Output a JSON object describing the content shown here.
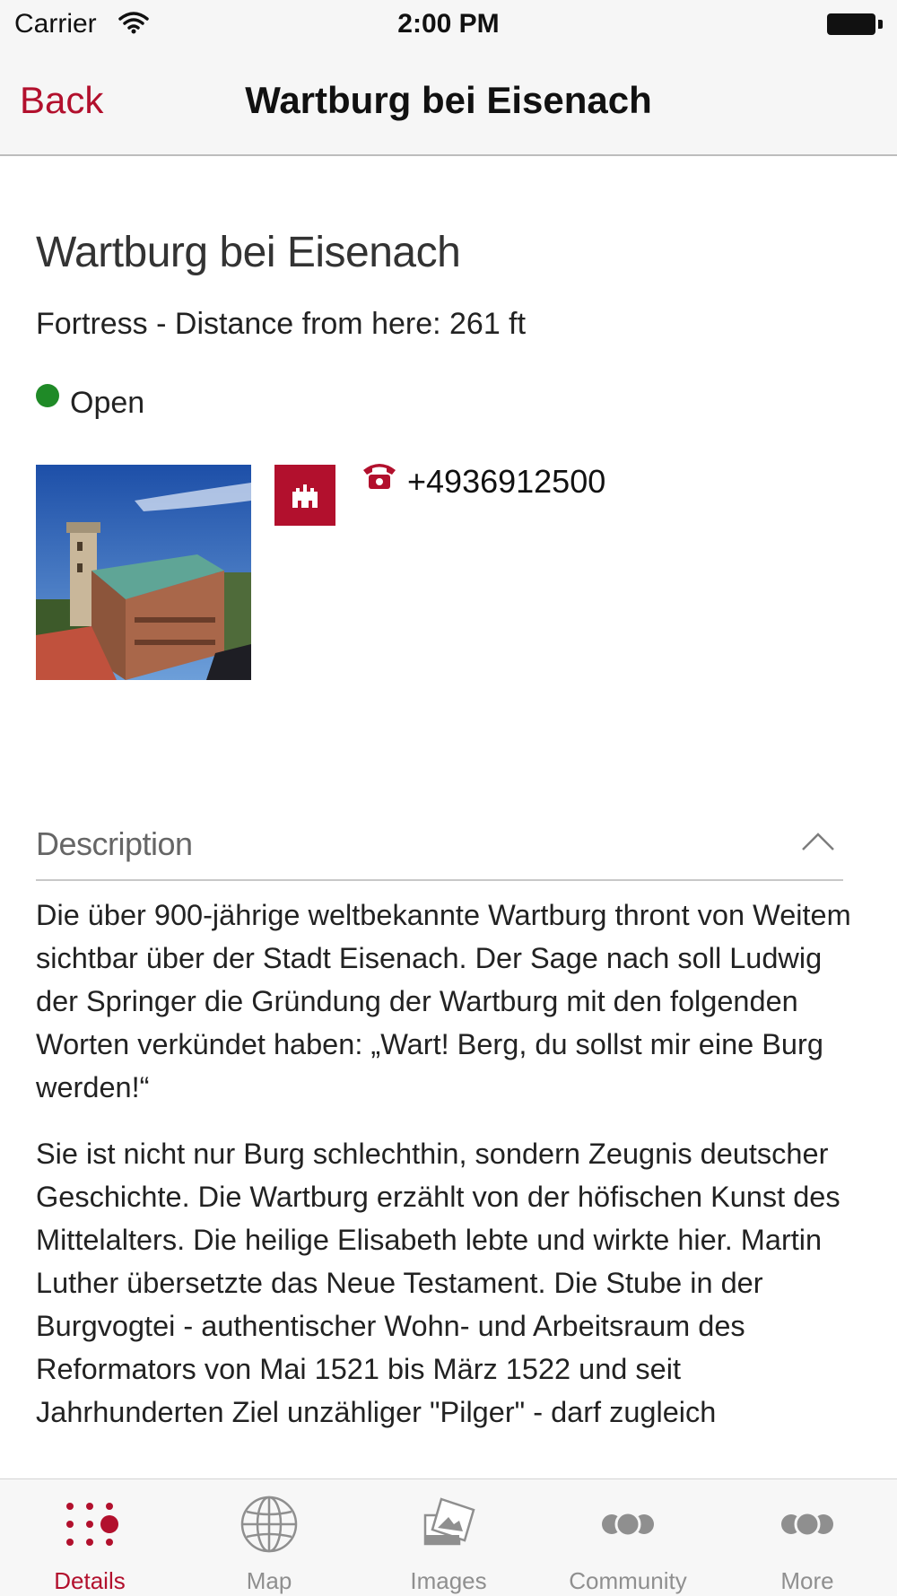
{
  "status_bar": {
    "carrier": "Carrier",
    "time": "2:00 PM"
  },
  "nav": {
    "back_label": "Back",
    "title": "Wartburg bei Eisenach"
  },
  "place": {
    "title": "Wartburg bei Eisenach",
    "subtitle": "Fortress - Distance from here: 261 ft",
    "status": "Open",
    "status_color": "#1f8a27",
    "phone": "+4936912500"
  },
  "description": {
    "label": "Description",
    "paragraphs": [
      "Die über 900-jährige weltbekannte Wartburg thront von Weitem sichtbar über der Stadt Eisenach. Der Sage nach soll Ludwig der Springer die Gründung der Wartburg mit den folgenden Worten verkündet haben: „Wart! Berg, du sollst mir eine Burg werden!“",
      "Sie ist nicht nur Burg schlechthin, sondern Zeugnis deutscher Geschichte. Die Wartburg erzählt von der höfischen Kunst des Mittelalters. Die heilige Elisabeth lebte und wirkte hier. Martin Luther übersetzte das Neue Testament. Die Stube in der Burgvogtei - authentischer Wohn- und Arbeitsraum des Reformators von Mai 1521 bis März 1522 und seit Jahrhunderten Ziel unzähliger \"Pilger\" - darf zugleich"
    ]
  },
  "tabs": [
    {
      "label": "Details",
      "icon": "dots-grid-icon",
      "active": true
    },
    {
      "label": "Map",
      "icon": "globe-icon",
      "active": false
    },
    {
      "label": "Images",
      "icon": "images-icon",
      "active": false
    },
    {
      "label": "Community",
      "icon": "people-icon",
      "active": false
    },
    {
      "label": "More",
      "icon": "more-icon",
      "active": false
    }
  ],
  "colors": {
    "accent": "#b2102d",
    "tab_inactive": "#8f8f8f",
    "open_green": "#1f8a27"
  }
}
